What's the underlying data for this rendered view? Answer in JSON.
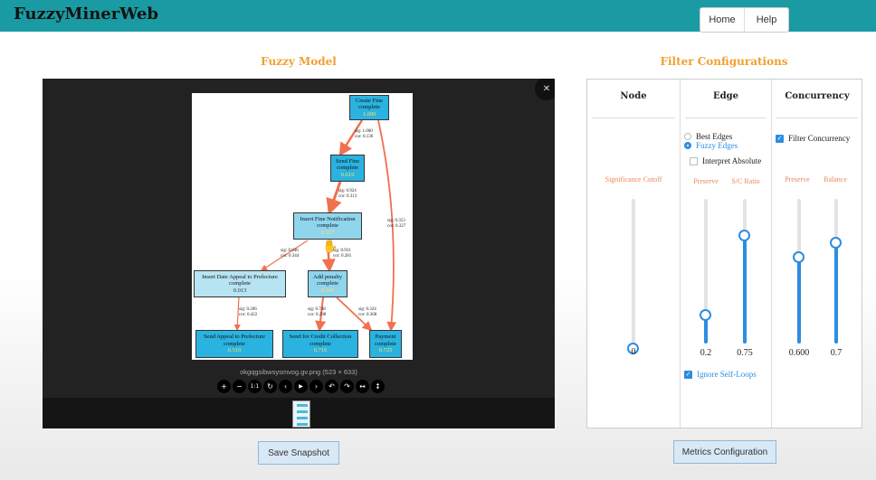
{
  "app": {
    "title": "FuzzyMinerWeb"
  },
  "nav": {
    "home": "Home",
    "help": "Help"
  },
  "model_section": {
    "title": "Fuzzy Model",
    "nodes": [
      {
        "label": "Create Fine",
        "type": "complete",
        "value": "1.000"
      },
      {
        "label": "Send Fine",
        "type": "complete",
        "value": "0.619"
      },
      {
        "label": "Insert Fine Notification",
        "type": "complete",
        "value": "0.357"
      },
      {
        "label": "Insert Date Appeal to Prefecture",
        "type": "complete",
        "value": "0.013"
      },
      {
        "label": "Add penalty",
        "type": "complete",
        "value": "0.341"
      },
      {
        "label": "Send Appeal to Prefecture",
        "type": "complete",
        "value": "0.510"
      },
      {
        "label": "Send for Credit Collection",
        "type": "complete",
        "value": "0.716"
      },
      {
        "label": "Payment",
        "type": "complete",
        "value": "0.725"
      }
    ],
    "edge_labels": [
      {
        "sig": "sig: 1.000",
        "cor": "cor: 0.136"
      },
      {
        "sig": "sig: 0.924",
        "cor": "cor: 0.313"
      },
      {
        "sig": "sig: 0.353",
        "cor": "cor: 0.327"
      },
      {
        "sig": "sig: 0.846",
        "cor": "cor: 0.344"
      },
      {
        "sig": "sig: 0.931",
        "cor": "cor: 0.281"
      },
      {
        "sig": "sig: 0.206",
        "cor": "cor: 0.422"
      },
      {
        "sig": "sig: 0.748",
        "cor": "cor: 0.298"
      },
      {
        "sig": "sig: 0.324",
        "cor": "cor: 0.368"
      }
    ],
    "caption": "okgqgsibwsysmvog.gv.png (523 × 633)",
    "toolbar_icons": [
      "zoom-in-icon",
      "zoom-out-icon",
      "actual-size-icon",
      "reset-icon",
      "prev-icon",
      "play-icon",
      "next-icon",
      "rotate-left-icon",
      "rotate-right-icon",
      "flip-horizontal-icon",
      "flip-vertical-icon"
    ],
    "toolbar_glyphs": [
      "+",
      "−",
      "1:1",
      "↻",
      "‹",
      "▶",
      "›",
      "↶",
      "↷",
      "↔",
      "↕"
    ],
    "save_button": "Save Snapshot"
  },
  "filter_section": {
    "title": "Filter Configurations",
    "node": {
      "title": "Node",
      "slider_label": "Significance Cutoff",
      "significance_cutoff": 0,
      "value_text": "0"
    },
    "edge": {
      "title": "Edge",
      "options": {
        "best": "Best Edges",
        "fuzzy": "Fuzzy Edges",
        "selected": "fuzzy"
      },
      "interpret_absolute": {
        "label": "Interpret Absolute",
        "checked": false
      },
      "preserve": {
        "label": "Preserve",
        "value": 0.2,
        "text": "0.2"
      },
      "sc_ratio": {
        "label": "S/C Ratio",
        "value": 0.75,
        "text": "0.75"
      },
      "ignore_self_loops": {
        "label": "Ignore Self-Loops",
        "checked": true
      }
    },
    "concurrency": {
      "title": "Concurrency",
      "filter": {
        "label": "Filter Concurrency",
        "checked": true
      },
      "preserve": {
        "label": "Preserve",
        "value": 0.6,
        "text": "0.600"
      },
      "balance": {
        "label": "Balance",
        "value": 0.7,
        "text": "0.7"
      }
    },
    "metrics_button": "Metrics Configuration"
  },
  "colors": {
    "navbar": "#1a9aa2",
    "accent_title": "#f0a030",
    "slider": "#2d8de0",
    "edge": "#f07050",
    "node": "#2ab3e0"
  }
}
